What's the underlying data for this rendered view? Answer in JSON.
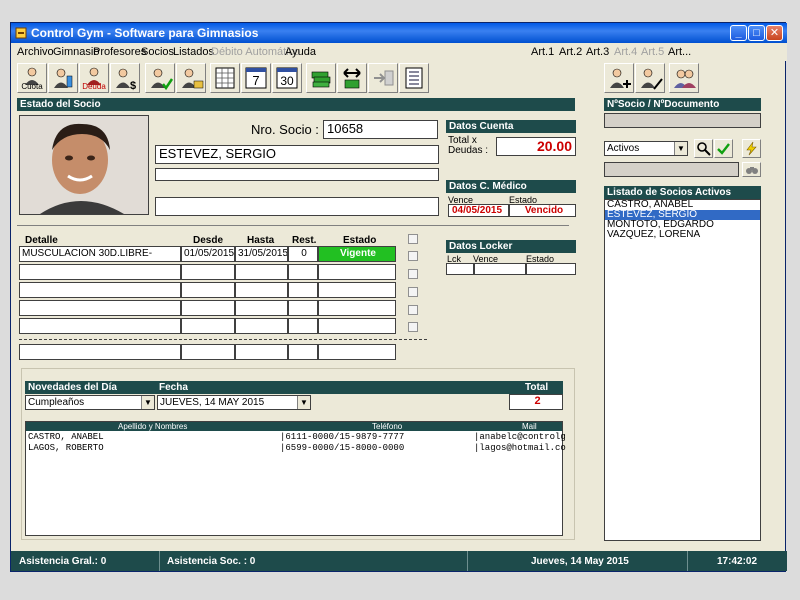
{
  "window": {
    "title": "Control Gym - Software para Gimnasios"
  },
  "menu": {
    "items": [
      "Archivo",
      "Gimnasio",
      "Profesores",
      "Socios",
      "Listados",
      "Débito Automático",
      "Ayuda"
    ],
    "articles": [
      "Art.1",
      "Art.2",
      "Art.3",
      "Art.4",
      "Art.5",
      "Art..."
    ]
  },
  "toolbar": {
    "cuota_label": "Cuota",
    "deuda_label": "Deuda",
    "cal_day": "7",
    "cal_month": "30"
  },
  "socio": {
    "section_title": "Estado del Socio",
    "nro_label": "Nro. Socio :",
    "nro_value": "10658",
    "name": "ESTEVEZ, SERGIO",
    "line2": "",
    "line3": ""
  },
  "cuenta": {
    "title": "Datos Cuenta",
    "total_label": "Total x",
    "deudas_label": "Deudas :",
    "amount": "20.00"
  },
  "medico": {
    "title": "Datos C. Médico",
    "vence_label": "Vence",
    "estado_label": "Estado",
    "vence_value": "04/05/2015",
    "estado_value": "Vencido"
  },
  "locker": {
    "title": "Datos Locker",
    "lck_label": "Lck",
    "vence_label": "Vence",
    "estado_label": "Estado"
  },
  "activities": {
    "headers": {
      "detalle": "Detalle",
      "desde": "Desde",
      "hasta": "Hasta",
      "rest": "Rest.",
      "estado": "Estado"
    },
    "row1": {
      "detalle": "MUSCULACION  30D.LIBRE-",
      "desde": "01/05/2015",
      "hasta": "31/05/2015",
      "rest": "0",
      "estado": "Vigente"
    }
  },
  "novedades": {
    "title": "Novedades del Día",
    "fecha_label": "Fecha",
    "total_label": "Total",
    "type_value": "Cumpleaños",
    "date_value": "JUEVES, 14 MAY 2015",
    "total_value": "2",
    "col_name": "Apellido y Nombres",
    "col_phone": "Teléfono",
    "col_mail": "Mail",
    "rows": [
      {
        "name": "CASTRO, ANABEL",
        "phone": "|6111-0000/15-9879-7777",
        "mail": "|anabelc@controlg"
      },
      {
        "name": "LAGOS, ROBERTO",
        "phone": "|6599-0000/15-8000-0000",
        "mail": "|lagos@hotmail.co"
      }
    ]
  },
  "right": {
    "search_title": "NºSocio / NºDocumento",
    "filter_value": "Activos",
    "list_title": "Listado de Socios Activos",
    "socios": [
      "CASTRO, ANABEL",
      "ESTEVEZ, SERGIO",
      "MONTOTO, EDGARDO",
      "VAZQUEZ, LORENA"
    ]
  },
  "status": {
    "asistencia_gral": "Asistencia Gral.: 0",
    "asistencia_soc": "Asistencia Soc. : 0",
    "date": "Jueves, 14 May 2015",
    "time": "17:42:02"
  },
  "colors": {
    "header_bg": "#1e4b4b",
    "vigente_bg": "#22c022",
    "alert_red": "#cc0000",
    "selection": "#316ac5"
  }
}
